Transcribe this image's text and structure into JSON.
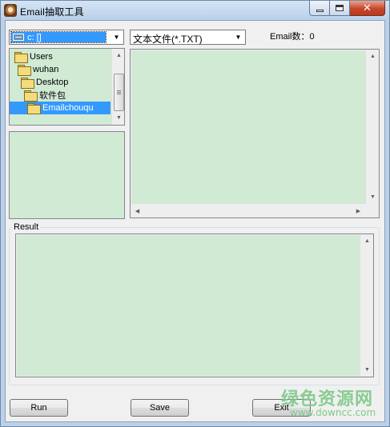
{
  "window": {
    "title": "Email抽取工具",
    "controls": {
      "minimize": "minimize-icon",
      "maximize": "maximize-icon",
      "close": "close-icon"
    }
  },
  "drive_select": {
    "value": "c: []"
  },
  "filter_select": {
    "value": "文本文件(*.TXT)"
  },
  "email_count": {
    "label": "Email数：",
    "value": "0"
  },
  "folder_tree": {
    "items": [
      {
        "label": "Users",
        "level": 0,
        "selected": false
      },
      {
        "label": "wuhan",
        "level": 1,
        "selected": false
      },
      {
        "label": "Desktop",
        "level": 2,
        "selected": false
      },
      {
        "label": "软件包",
        "level": 3,
        "selected": false
      },
      {
        "label": "Emailchouqu",
        "level": 4,
        "selected": true
      }
    ]
  },
  "result": {
    "label": "Result"
  },
  "buttons": {
    "run": "Run",
    "save": "Save",
    "exit": "Exit"
  },
  "watermark": {
    "name": "绿色资源网",
    "url": "www.downcc.com"
  },
  "colors": {
    "pane_green": "#d0ead4",
    "selection_blue": "#3399ff"
  }
}
